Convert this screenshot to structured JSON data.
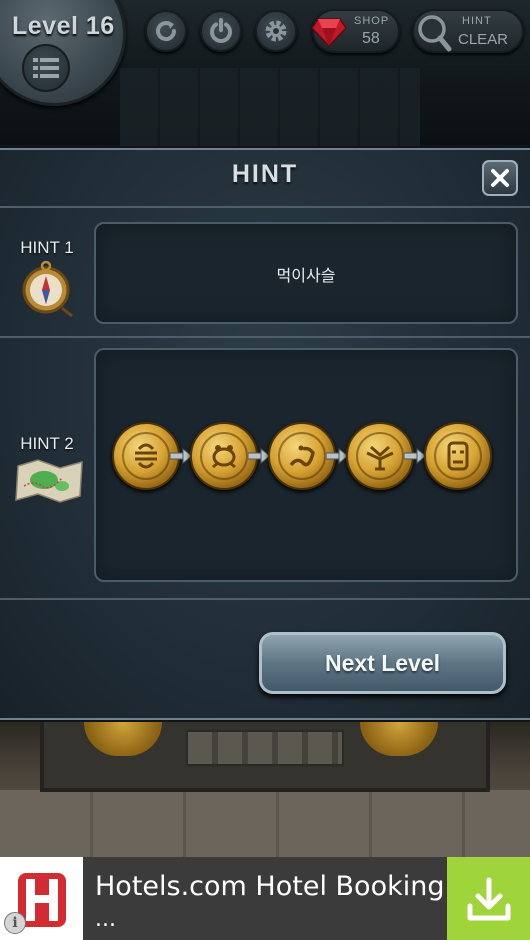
{
  "header": {
    "level_label": "Level 16",
    "buttons": [
      {
        "icon": "refresh-icon"
      },
      {
        "icon": "power-icon"
      },
      {
        "icon": "gear-icon"
      }
    ],
    "shop": {
      "label": "SHOP",
      "count": "58",
      "icon": "gem-icon"
    },
    "hint_clear": {
      "label_top": "HINT",
      "label_bottom": "CLEAR",
      "icon": "magnifier-icon"
    }
  },
  "hint_dialog": {
    "title": "HINT",
    "hints": [
      {
        "label": "HINT 1",
        "icon": "compass-icon",
        "text": "먹이사슬"
      },
      {
        "label": "HINT 2",
        "icon": "map-icon",
        "coin_count": 5
      }
    ],
    "next_button_label": "Next Level"
  },
  "ad_banner": {
    "title": "Hotels.com Hotel Booking",
    "subtitle": "...",
    "icon_download": "download-icon",
    "icon_info": "info-icon",
    "info_glyph": "i"
  },
  "colors": {
    "panel_border": "#6f8290",
    "gold": "#d6a233",
    "ad_accent": "#9fd43b",
    "hotels_red": "#d42a32"
  }
}
